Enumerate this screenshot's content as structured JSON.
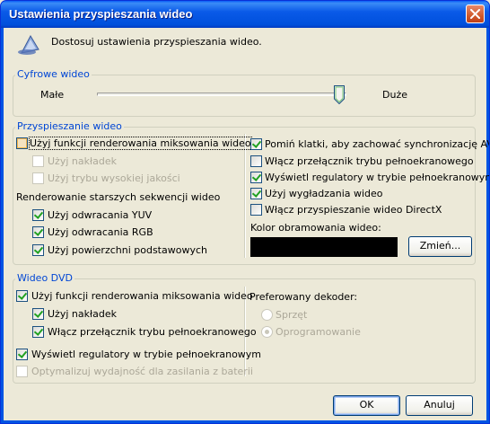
{
  "window": {
    "title": "Ustawienia przyspieszania wideo"
  },
  "header": {
    "description": "Dostosuj ustawienia przyspieszania wideo."
  },
  "digital_video": {
    "legend": "Cyfrowe wideo",
    "min_label": "Małe",
    "max_label": "Duże",
    "slider_value": 1.0
  },
  "acceleration": {
    "legend": "Przyspieszanie wideo",
    "left": {
      "mixing": {
        "label": "Użyj funkcji renderowania miksowania wideo",
        "checked": false
      },
      "overlays": {
        "label": "Użyj nakładek",
        "checked": false,
        "disabled": true
      },
      "high_quality": {
        "label": "Użyj trybu wysokiej jakości",
        "checked": false,
        "disabled": true
      },
      "legacy_label": "Renderowanie starszych sekwencji wideo",
      "yuv": {
        "label": "Użyj odwracania YUV",
        "checked": true
      },
      "rgb": {
        "label": "Użyj odwracania RGB",
        "checked": true
      },
      "surfaces": {
        "label": "Użyj powierzchni podstawowych",
        "checked": true
      }
    },
    "right": {
      "skip_frames": {
        "label": "Pomiń klatki, aby zachować synchronizację AV",
        "checked": true
      },
      "fullscreen_switch": {
        "label": "Włącz przełącznik trybu pełnoekranowego",
        "checked": false
      },
      "fullscreen_controls": {
        "label": "Wyświetl regulatory w trybie pełnoekranowym",
        "checked": true
      },
      "smoothing": {
        "label": "Użyj wygładzania wideo",
        "checked": true
      },
      "directx": {
        "label": "Włącz przyspieszanie wideo DirectX",
        "checked": false
      },
      "border_color_label": "Kolor obramowania wideo:",
      "border_color": "#000000",
      "change_button": "Zmień..."
    }
  },
  "dvd": {
    "legend": "Wideo DVD",
    "mixing": {
      "label": "Użyj funkcji renderowania miksowania wideo",
      "checked": true
    },
    "overlays": {
      "label": "Użyj nakładek",
      "checked": true
    },
    "fullscreen_switch": {
      "label": "Włącz przełącznik trybu pełnoekranowego",
      "checked": true
    },
    "fullscreen_controls": {
      "label": "Wyświetl regulatory w trybie pełnoekranowym",
      "checked": true
    },
    "battery": {
      "label": "Optymalizuj wydajność dla zasilania z baterii",
      "checked": false,
      "disabled": true
    },
    "decoder_label": "Preferowany dekoder:",
    "hardware": {
      "label": "Sprzęt",
      "selected": false,
      "disabled": true
    },
    "software": {
      "label": "Oprogramowanie",
      "selected": true,
      "disabled": true
    }
  },
  "buttons": {
    "ok": "OK",
    "cancel": "Anuluj"
  },
  "colors": {
    "title_bar": "#0054e3",
    "dialog_bg": "#ece9d8",
    "group_legend": "#0046d5",
    "check_mark": "#21a121",
    "close_button": "#d05a2c"
  }
}
